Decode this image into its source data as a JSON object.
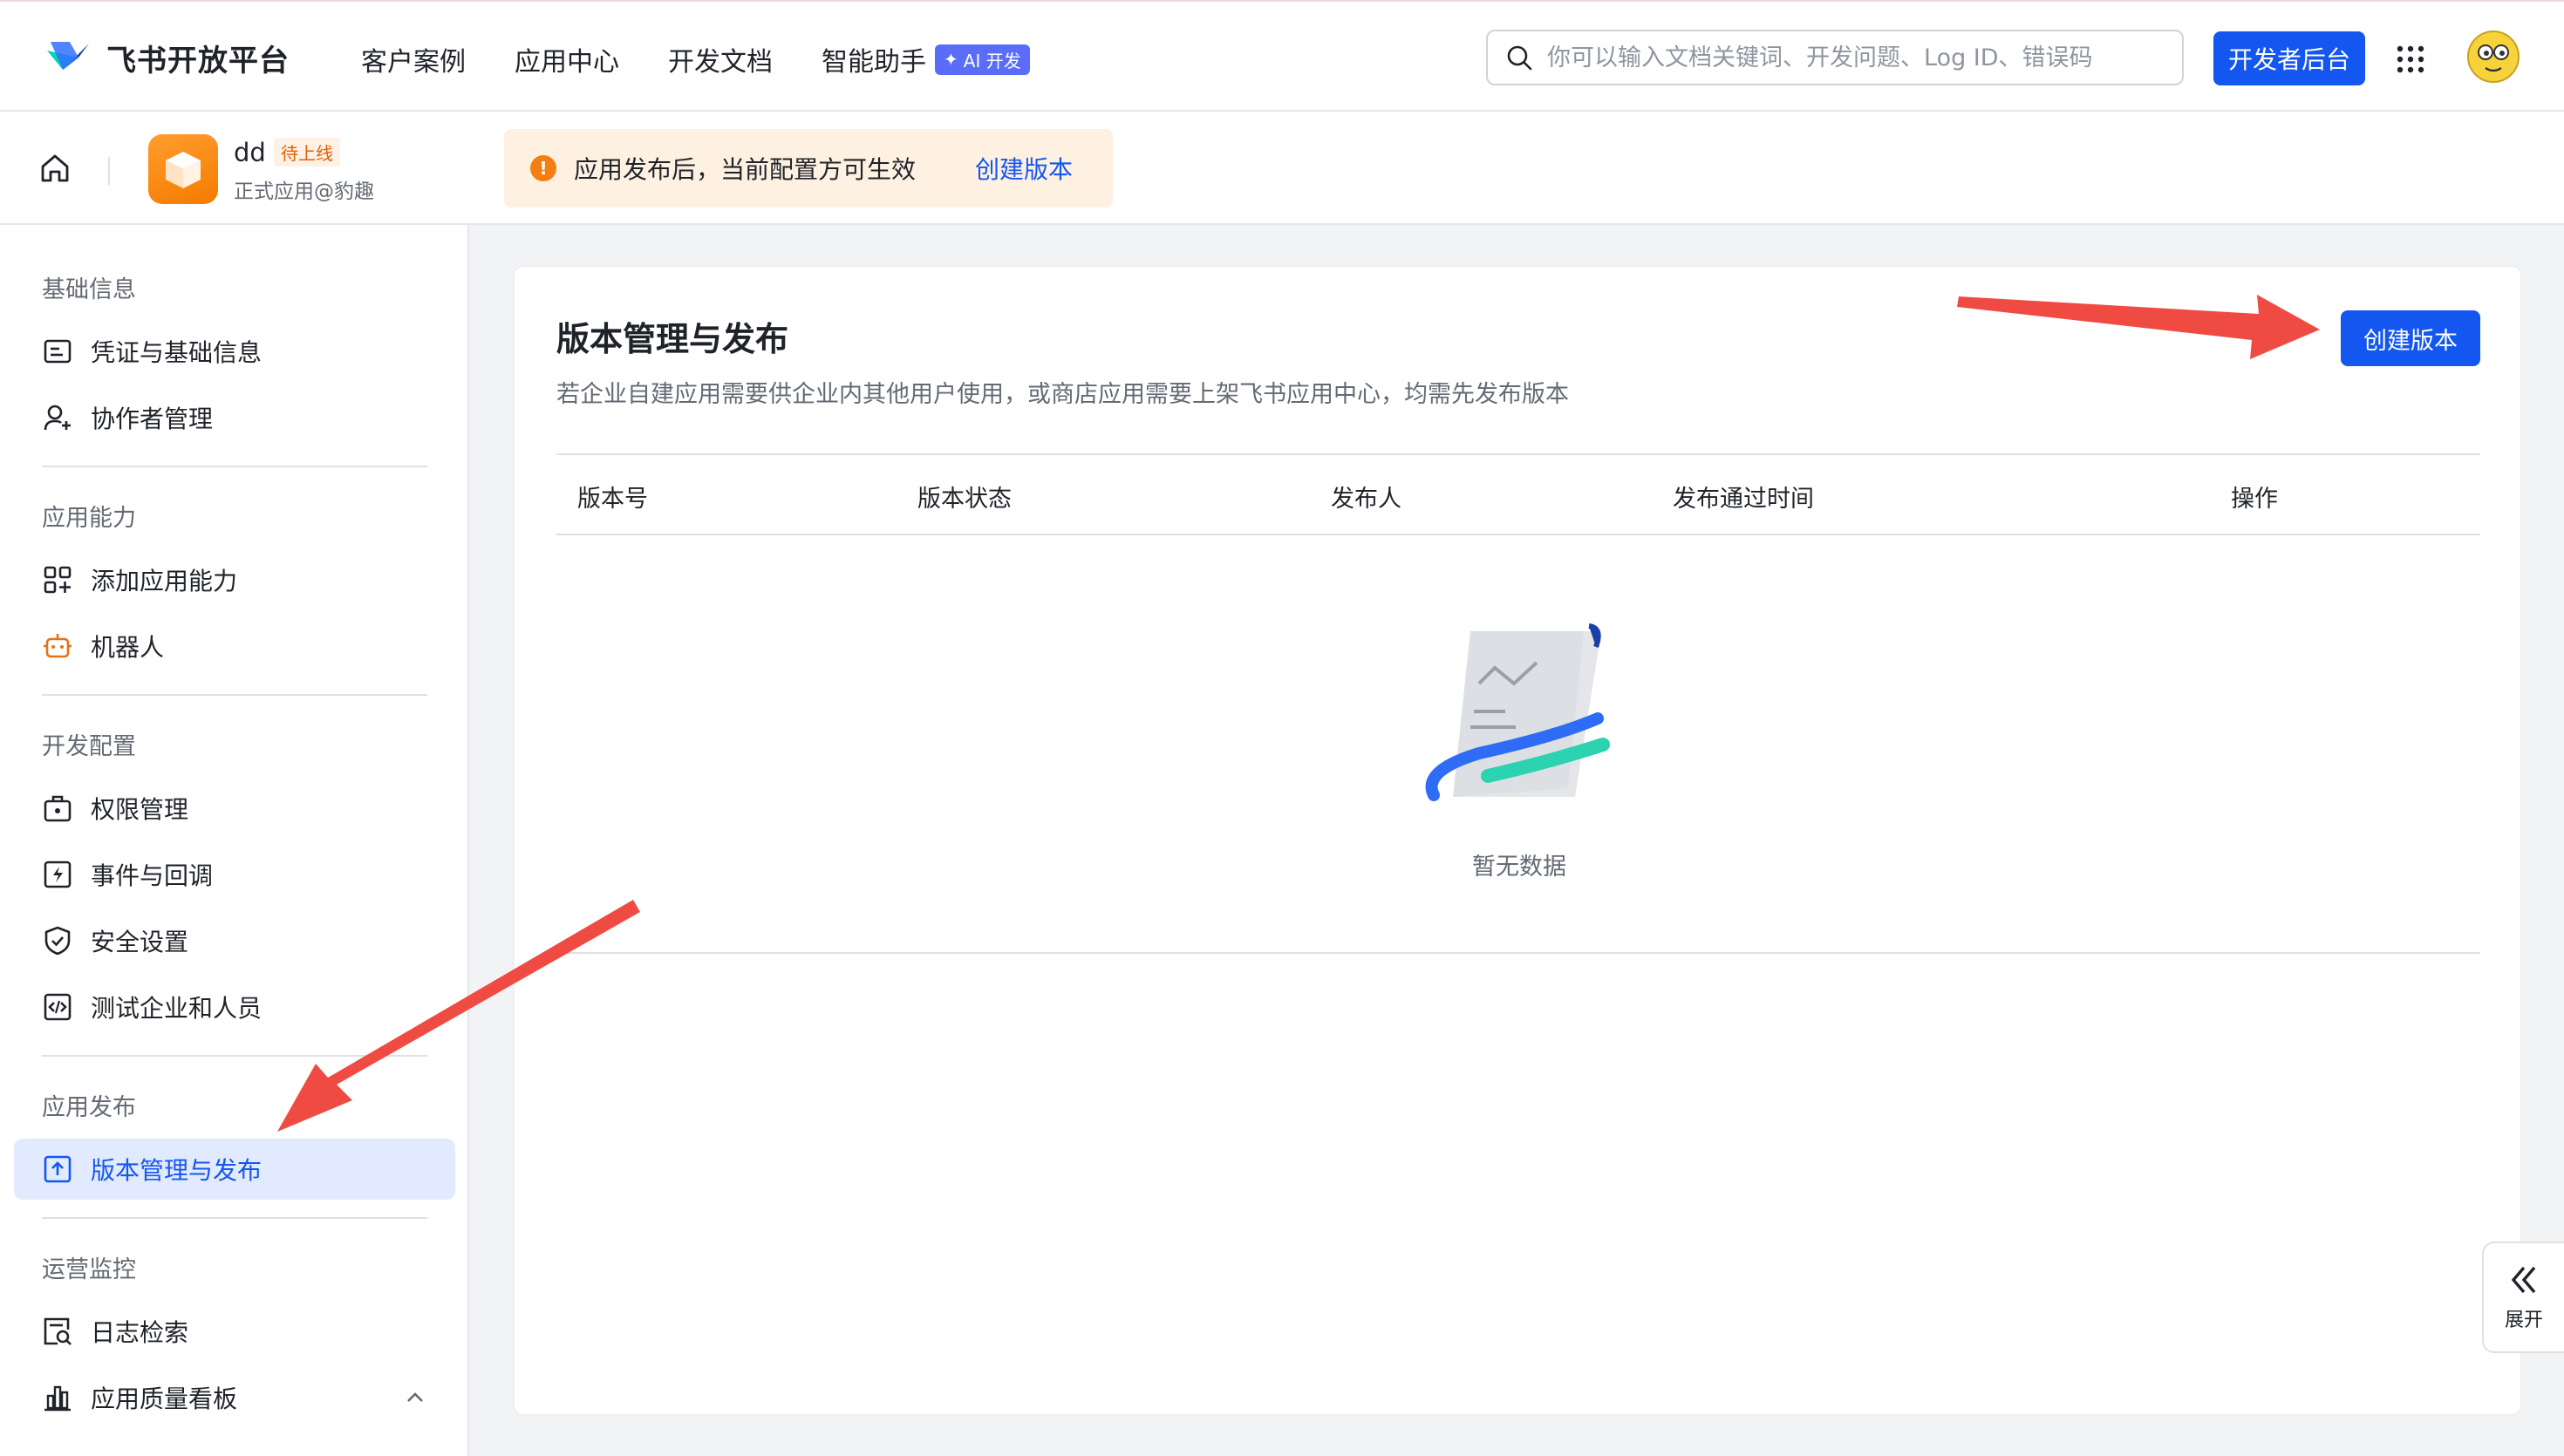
{
  "brand": {
    "name": "飞书开放平台"
  },
  "nav": {
    "links": [
      "客户案例",
      "应用中心",
      "开发文档",
      "智能助手"
    ],
    "ai_badge": "AI 开发"
  },
  "search": {
    "placeholder": "你可以输入文档关键词、开发问题、Log ID、错误码"
  },
  "dev_console": "开发者后台",
  "app": {
    "name": "dd",
    "status": "待上线",
    "subtitle": "正式应用@豹趣"
  },
  "notice": {
    "text": "应用发布后，当前配置方可生效",
    "link": "创建版本"
  },
  "sidebar": {
    "sections": [
      {
        "title": "基础信息",
        "items": [
          "凭证与基础信息",
          "协作者管理"
        ]
      },
      {
        "title": "应用能力",
        "items": [
          "添加应用能力",
          "机器人"
        ]
      },
      {
        "title": "开发配置",
        "items": [
          "权限管理",
          "事件与回调",
          "安全设置",
          "测试企业和人员"
        ]
      },
      {
        "title": "应用发布",
        "items": [
          "版本管理与发布"
        ]
      },
      {
        "title": "运营监控",
        "items": [
          "日志检索",
          "应用质量看板"
        ]
      }
    ]
  },
  "main": {
    "title": "版本管理与发布",
    "description": "若企业自建应用需要供企业内其他用户使用，或商店应用需要上架飞书应用中心，均需先发布版本",
    "create_button": "创建版本",
    "columns": [
      "版本号",
      "版本状态",
      "发布人",
      "发布通过时间",
      "操作"
    ],
    "empty_text": "暂无数据"
  },
  "expand": {
    "label": "展开"
  },
  "colors": {
    "primary": "#1456f0",
    "annotation": "#f04b43",
    "warning": "#f57e14"
  }
}
